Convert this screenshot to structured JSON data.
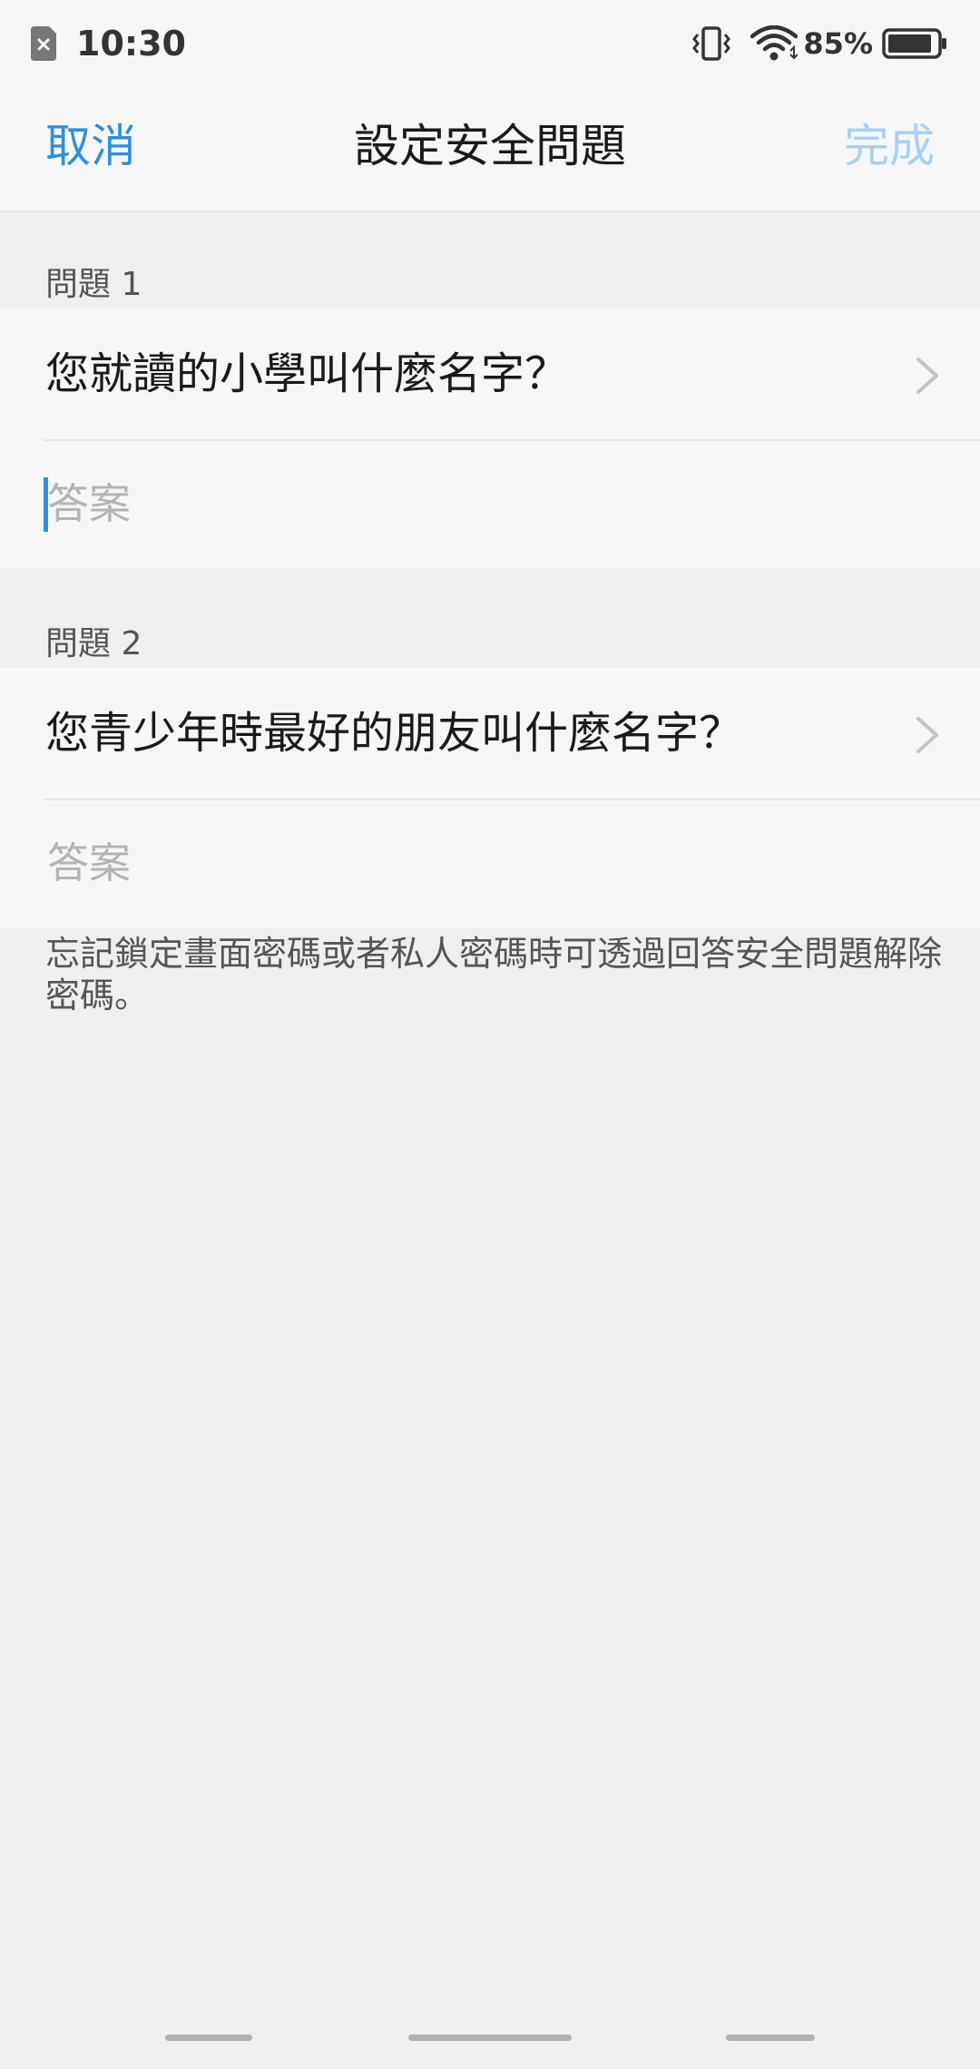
{
  "status_bar": {
    "time": "10:30",
    "battery_text": "85%",
    "icons": [
      "sim-error-icon",
      "vibrate-icon",
      "wifi-icon",
      "battery-icon"
    ]
  },
  "header": {
    "cancel_label": "取消",
    "title": "設定安全問題",
    "done_label": "完成"
  },
  "questions": [
    {
      "section_label": "問題 1",
      "question": "您就讀的小學叫什麼名字？",
      "answer_placeholder": "答案",
      "answer_value": ""
    },
    {
      "section_label": "問題 2",
      "question": "您青少年時最好的朋友叫什麼名字？",
      "answer_placeholder": "答案",
      "answer_value": ""
    }
  ],
  "hint_text": "忘記鎖定畫面密碼或者私人密碼時可透過回答安全問題解除密碼。",
  "colors": {
    "accent": "#2e8fdc",
    "accent_disabled": "#a8d0f2",
    "background": "#efefef",
    "surface": "#f6f6f6"
  }
}
